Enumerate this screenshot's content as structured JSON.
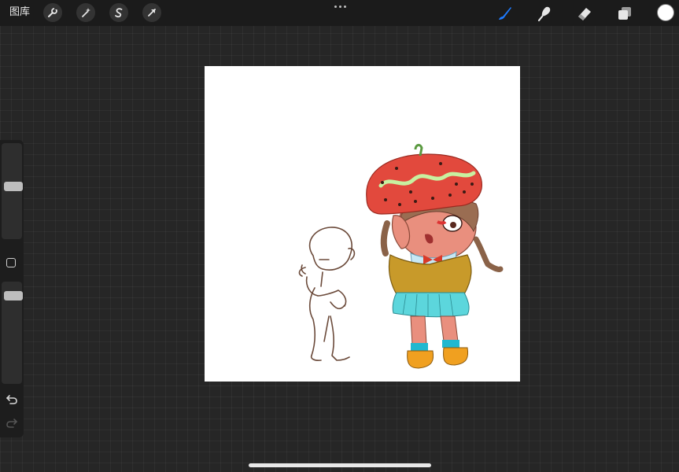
{
  "toolbar": {
    "gallery_label": "图库",
    "left_tools": [
      {
        "name": "actions",
        "icon": "wrench-icon"
      },
      {
        "name": "adjustments",
        "icon": "magic-wand-icon"
      },
      {
        "name": "selection",
        "icon": "selection-s-icon"
      },
      {
        "name": "transform",
        "icon": "arrow-cursor-icon"
      }
    ],
    "more_icon": "more-dots-icon",
    "right_tools": [
      {
        "name": "brush",
        "icon": "brush-icon",
        "active": true
      },
      {
        "name": "smudge",
        "icon": "smudge-icon",
        "active": false
      },
      {
        "name": "eraser",
        "icon": "eraser-icon",
        "active": false
      },
      {
        "name": "layers",
        "icon": "layers-icon",
        "active": false
      }
    ],
    "current_color": "#ffffff",
    "active_color": "#1e7bff"
  },
  "sidebar": {
    "brush_size_level": 0.55,
    "opacity_level": 0.9,
    "modify_icon": "square-icon",
    "undo_icon": "undo-icon",
    "redo_icon": "redo-icon"
  },
  "canvas": {
    "background": "#ffffff"
  }
}
